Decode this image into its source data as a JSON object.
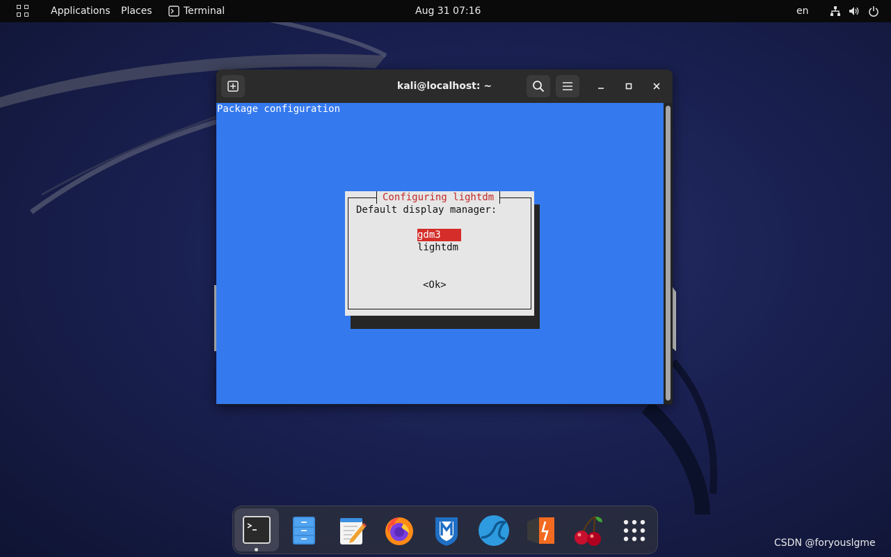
{
  "topbar": {
    "activities_icon": "grid-icon",
    "applications": "Applications",
    "places": "Places",
    "terminal_app": "Terminal",
    "clock": "Aug 31  07:16",
    "lang": "en",
    "tray_icons": [
      "network-icon",
      "volume-icon",
      "power-icon"
    ]
  },
  "terminal_window": {
    "title": "kali@localhost: ~",
    "new_tab_icon": "new-tab-icon",
    "search_icon": "search-icon",
    "menu_icon": "hamburger-menu-icon",
    "minimize_icon": "minimize-icon",
    "maximize_icon": "maximize-icon",
    "close_icon": "close-icon",
    "content": {
      "header": "Package configuration",
      "dialog": {
        "title": "Configuring lightdm",
        "label": "Default display manager:",
        "options": [
          "gdm3",
          "lightdm"
        ],
        "selected": "gdm3",
        "ok_button": "<Ok>"
      }
    }
  },
  "dock": {
    "items": [
      {
        "name": "terminal",
        "icon": "terminal-icon",
        "active": true
      },
      {
        "name": "files",
        "icon": "file-manager-icon"
      },
      {
        "name": "text-editor",
        "icon": "text-editor-icon"
      },
      {
        "name": "firefox",
        "icon": "firefox-icon"
      },
      {
        "name": "metasploit",
        "icon": "metasploit-icon"
      },
      {
        "name": "wireshark",
        "icon": "wireshark-icon"
      },
      {
        "name": "burpsuite",
        "icon": "burpsuite-icon"
      },
      {
        "name": "cherrytree",
        "icon": "cherry-icon"
      },
      {
        "name": "show-apps",
        "icon": "app-grid-icon"
      }
    ]
  },
  "watermark": "CSDN @foryouslgme",
  "colors": {
    "terminal_bg": "#3579ee",
    "dialog_bg": "#e6e6e6",
    "dialog_title": "#c0282a",
    "selection": "#d42d2a",
    "topbar": "#0a0a0a"
  }
}
